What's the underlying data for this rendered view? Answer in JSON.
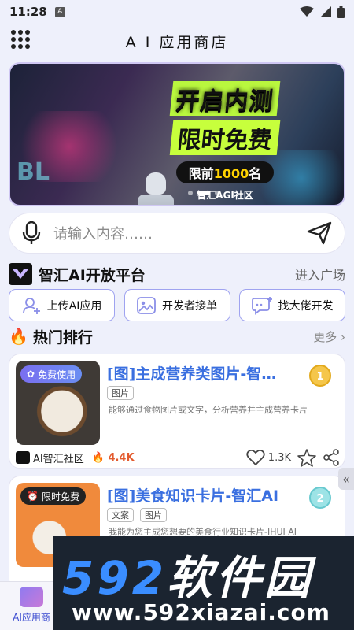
{
  "status_bar": {
    "time": "11:28",
    "notif_badge": "A"
  },
  "header": {
    "title": "A I 应用商店"
  },
  "banner": {
    "wall_text": "BL",
    "line1": "开启内测",
    "line2": "限时免费",
    "line3_prefix": "限前",
    "line3_num": "1000",
    "line3_suffix": "名",
    "line4": "智汇AGI社区"
  },
  "search": {
    "placeholder": "请输入内容……"
  },
  "platform": {
    "name": "智汇AI开放平台",
    "link": "进入广场"
  },
  "actions": [
    {
      "label": "上传AI应用"
    },
    {
      "label": "开发者接单"
    },
    {
      "label": "找大佬开发"
    }
  ],
  "hot": {
    "title": "热门排行",
    "more": "更多"
  },
  "cards": [
    {
      "tag": "免费使用",
      "title": "[图]主成营养类图片-智…",
      "rank": "1",
      "chips": [
        "图片"
      ],
      "desc": "能够通过食物图片或文字，分析营养并主成营养卡片",
      "author": "AI智汇社区",
      "hot": "4.4K",
      "likes": "1.3K"
    },
    {
      "tag": "限时免费",
      "title": "[图]美食知识卡片-智汇AI",
      "rank": "2",
      "chips": [
        "文案",
        "图片"
      ],
      "desc": "我能为您主成您想要的美食行业知识卡片-IHUI AI"
    }
  ],
  "bottom_nav": {
    "tab_label": "AI应用商"
  },
  "watermark": {
    "big_num": "592",
    "big_cn": "软件园",
    "url": "www.592xiazai.com"
  },
  "colors": {
    "accent": "#3a6fe0",
    "border": "#9fa3f0",
    "hot": "#e35b2e"
  }
}
